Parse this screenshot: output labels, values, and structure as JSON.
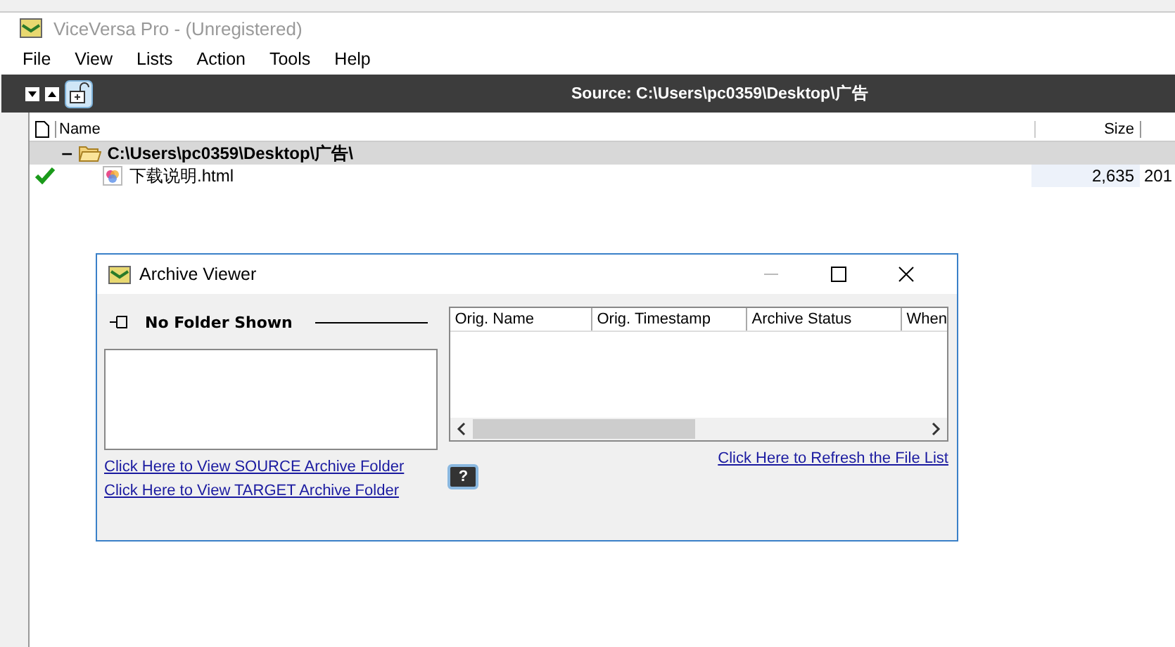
{
  "window": {
    "title": "ViceVersa Pro - (Unregistered)"
  },
  "menu": [
    "File",
    "View",
    "Lists",
    "Action",
    "Tools",
    "Help"
  ],
  "toolbar": {
    "source_label": "Source: C:\\Users\\pc0359\\Desktop\\广告"
  },
  "file_list": {
    "columns": [
      "Name",
      "Size"
    ],
    "folder": {
      "toggle": "−",
      "path": "C:\\Users\\pc0359\\Desktop\\广告\\"
    },
    "files": [
      {
        "name": "下载说明.html",
        "checked": true,
        "size": "2,635",
        "column_3": "201"
      }
    ]
  },
  "archive_viewer": {
    "title": "Archive Viewer",
    "folder_label": "No Folder Shown",
    "columns": [
      "Orig. Name",
      "Orig. Timestamp",
      "Archive Status",
      "When"
    ],
    "links": [
      "Click Here to View SOURCE Archive Folder",
      "Click Here to View TARGET Archive Folder"
    ],
    "refresh_link": "Click Here to Refresh the File List",
    "help_button": "?"
  }
}
